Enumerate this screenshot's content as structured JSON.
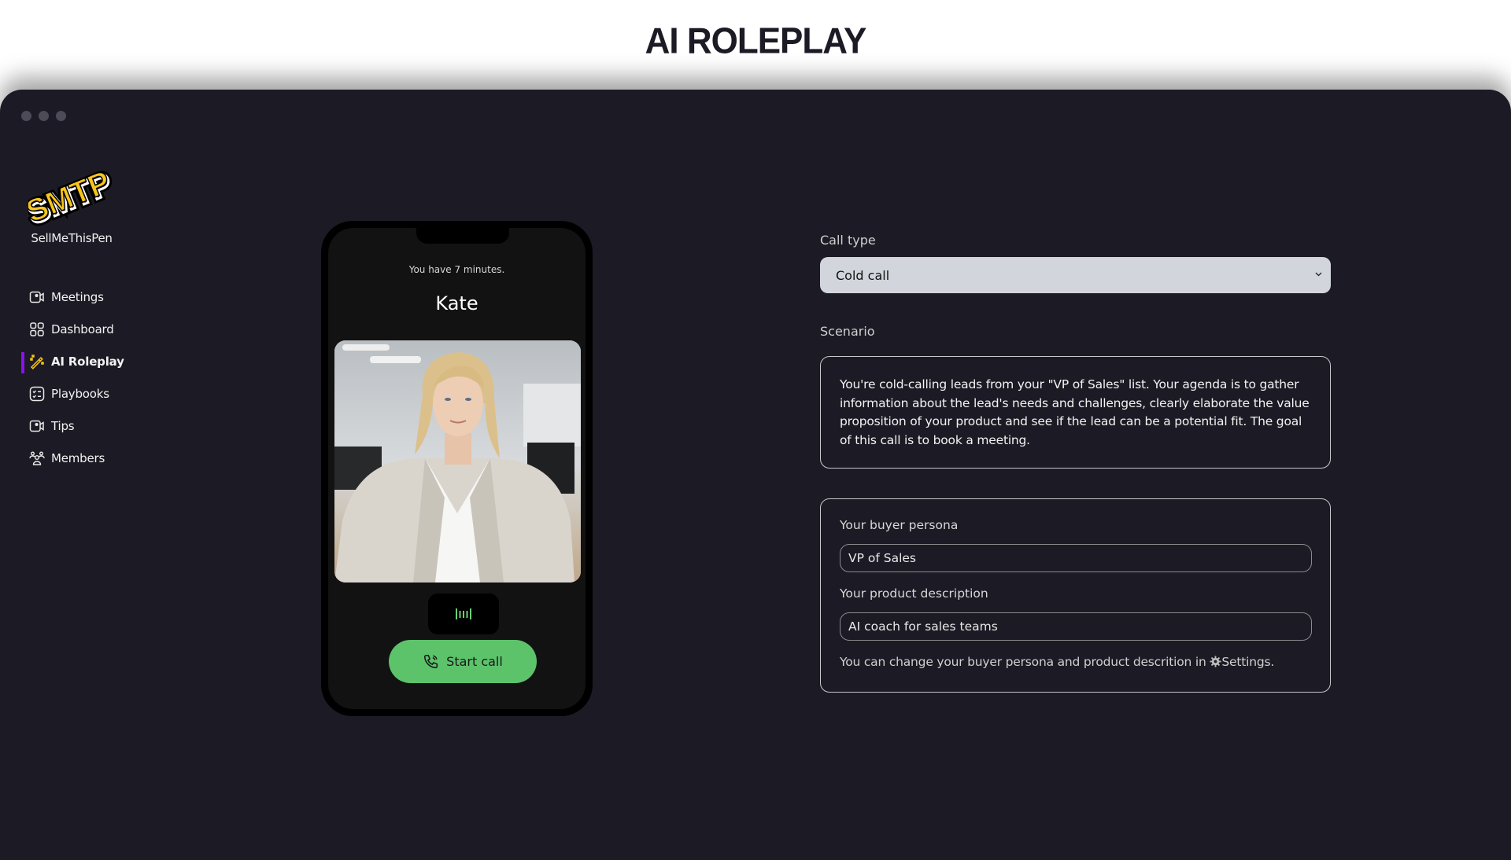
{
  "page": {
    "title": "AI ROLEPLAY"
  },
  "app": {
    "brand_name": "SellMeThisPen",
    "logo_text": "SMTP",
    "colors": {
      "accent": "#8b10f2",
      "logo_yellow": "#f7c51c",
      "call_green": "#5cc36b",
      "window_bg": "#1c1a24"
    }
  },
  "sidebar": {
    "items": [
      {
        "label": "Meetings",
        "icon": "video-icon",
        "active": false
      },
      {
        "label": "Dashboard",
        "icon": "grid-icon",
        "active": false
      },
      {
        "label": "AI Roleplay",
        "icon": "magic-wand-icon",
        "active": true
      },
      {
        "label": "Playbooks",
        "icon": "checklist-icon",
        "active": false
      },
      {
        "label": "Tips",
        "icon": "video-icon",
        "active": false
      },
      {
        "label": "Members",
        "icon": "users-icon",
        "active": false
      }
    ]
  },
  "phone": {
    "timer_text": "You have 7 minutes.",
    "caller_name": "Kate",
    "audio_indicator": "audio-wave-icon",
    "start_call_label": "Start call"
  },
  "form": {
    "call_type_label": "Call type",
    "call_type_value": "Cold call",
    "scenario_label": "Scenario",
    "scenario_text": "You're cold-calling leads from your \"VP of Sales\" list. Your agenda is to gather information about the lead's needs and challenges, clearly elaborate the value proposition of your product and see if the lead can be a potential fit. The goal of this call is to book a meeting.",
    "buyer_persona_label": "Your buyer persona",
    "buyer_persona_value": "VP of Sales",
    "product_description_label": "Your product description",
    "product_description_value": "AI coach for sales teams",
    "settings_note_prefix": "You can change your buyer persona and product descrition in ",
    "settings_link": "Settings."
  }
}
